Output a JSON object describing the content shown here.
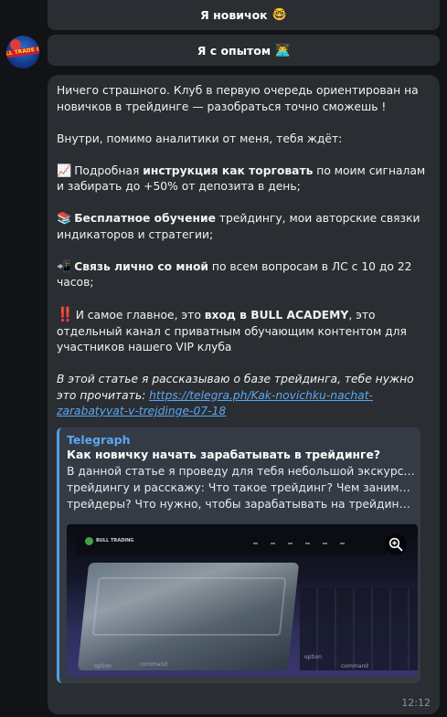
{
  "keyboard": {
    "newbie_label": "Я новичок",
    "newbie_emoji": "🤓",
    "experienced_label": "Я с опытом",
    "experienced_emoji": "👨‍💻"
  },
  "avatar": {
    "logo_text": "WALL TRADE GUY"
  },
  "message": {
    "p1": "Ничего страшного. Клуб в первую очередь ориентирован на новичков в трейдинге — разобраться точно сможешь !",
    "p2": "Внутри, помимо аналитики от меня, тебя ждёт:",
    "i1_emoji": "📈",
    "i1_pre": "Подробная ",
    "i1_bold": "инструкция как торговать",
    "i1_post": " по моим сигналам и забирать до +50% от депозита в день;",
    "i2_emoji": "📚",
    "i2_bold": "Бесплатное обучение",
    "i2_post": " трейдингу, мои авторские связки индикаторов и стратегии;",
    "i3_emoji": "📲",
    "i3_bold": "Связь лично со мной",
    "i3_post": " по всем вопросам в ЛС с 10 до 22 часов;",
    "i4_emoji": "‼️",
    "i4_pre": "И самое главное, это ",
    "i4_bold": "вход в BULL ACADEMY",
    "i4_post": ", это отдельный канал с приватным обучающим контентом для участников нашего VIP клуба",
    "article_text": "В этой статье я рассказываю о базе трейдинга, тебе нужно это прочитать: ",
    "article_link": "https://telegra.ph/Kak-novichku-nachat-zarabatyvat-v-trejdinge-07-18"
  },
  "preview": {
    "site": "Telegraph",
    "title": "Как новичку начать зарабатывать в трейдинге?",
    "desc_line1": "В данной статье я проведу для тебя небольшой экскурс по",
    "desc_line2": "трейдингу и расскажу: Что такое трейдинг? Чем занимаются",
    "desc_line3": "трейдеры? Что нужно, чтобы зарабатывать на трейдинге? К...",
    "image_logo": "BULL TRADING",
    "key_labels": [
      "option",
      "command",
      "option",
      "command"
    ]
  },
  "time": "12:12",
  "colors": {
    "bubble": "#2a2d32",
    "link": "#5aa7f0",
    "accent_bar": "#4f9fe3"
  }
}
